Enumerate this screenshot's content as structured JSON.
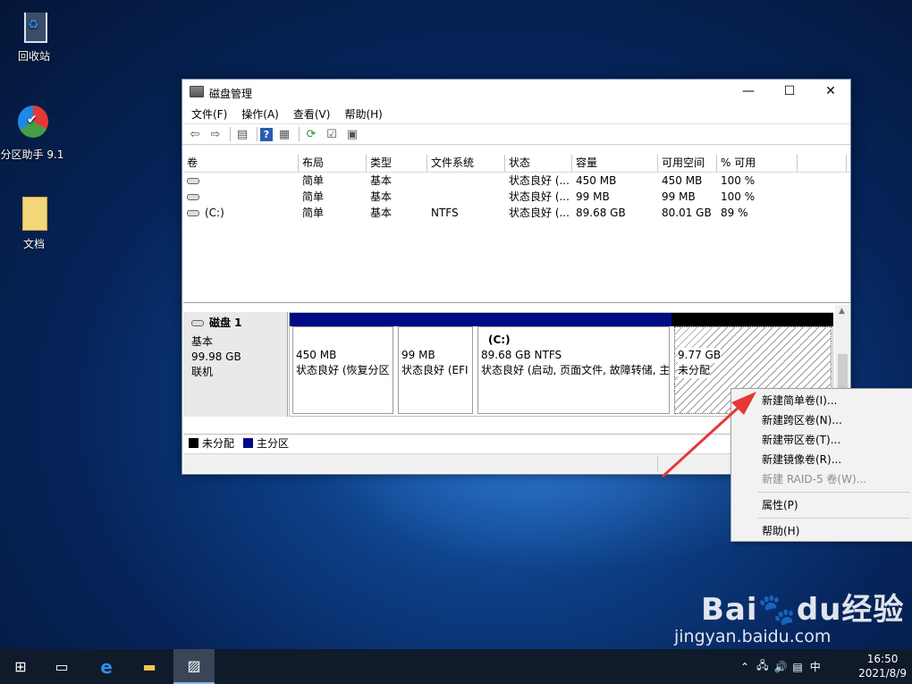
{
  "desktop": {
    "icons": [
      {
        "label": "回收站",
        "icon": "recycle-bin-icon"
      },
      {
        "label": "分区助手 9.1",
        "icon": "partition-assistant-icon"
      },
      {
        "label": "文档",
        "icon": "folder-icon"
      }
    ]
  },
  "window": {
    "title": "磁盘管理",
    "controls": {
      "minimize": "—",
      "maximize": "☐",
      "close": "✕"
    }
  },
  "menubar": {
    "items": [
      "文件(F)",
      "操作(A)",
      "查看(V)",
      "帮助(H)"
    ]
  },
  "toolbar": {
    "icons": [
      "back-icon",
      "forward-icon",
      "list-view-icon",
      "help-icon",
      "console-icon",
      "refresh-icon",
      "properties-icon",
      "export-icon"
    ]
  },
  "volume_list": {
    "columns": [
      "卷",
      "布局",
      "类型",
      "文件系统",
      "状态",
      "容量",
      "可用空间",
      "% 可用"
    ],
    "rows": [
      {
        "volume": "",
        "layout": "简单",
        "type": "基本",
        "fs": "",
        "status": "状态良好 (...",
        "capacity": "450 MB",
        "free": "450 MB",
        "pct": "100 %"
      },
      {
        "volume": "",
        "layout": "简单",
        "type": "基本",
        "fs": "",
        "status": "状态良好 (...",
        "capacity": "99 MB",
        "free": "99 MB",
        "pct": "100 %"
      },
      {
        "volume": "(C:)",
        "layout": "简单",
        "type": "基本",
        "fs": "NTFS",
        "status": "状态良好 (...",
        "capacity": "89.68 GB",
        "free": "80.01 GB",
        "pct": "89 %"
      }
    ]
  },
  "disk": {
    "name": "磁盘 1",
    "type": "基本",
    "size": "99.98 GB",
    "state": "联机",
    "partitions": [
      {
        "label": "",
        "size": "450 MB",
        "status": "状态良好 (恢复分区"
      },
      {
        "label": "",
        "size": "99 MB",
        "status": "状态良好 (EFI"
      },
      {
        "label": "(C:)",
        "size": "89.68 GB NTFS",
        "status": "状态良好 (启动, 页面文件, 故障转储, 主"
      },
      {
        "label": "",
        "size": "9.77 GB",
        "status": "未分配"
      }
    ]
  },
  "legend": {
    "unallocated": "未分配",
    "primary": "主分区"
  },
  "context_menu": {
    "items": [
      {
        "label": "新建简单卷(I)...",
        "enabled": true
      },
      {
        "label": "新建跨区卷(N)...",
        "enabled": true
      },
      {
        "label": "新建带区卷(T)...",
        "enabled": true
      },
      {
        "label": "新建镜像卷(R)...",
        "enabled": true
      },
      {
        "label": "新建 RAID-5 卷(W)...",
        "enabled": false
      },
      {
        "label": "属性(P)",
        "enabled": true
      },
      {
        "label": "帮助(H)",
        "enabled": true
      }
    ]
  },
  "taskbar": {
    "ime": "中",
    "time": "16:50",
    "date": "2021/8/9"
  },
  "watermark": {
    "brand": "Bai",
    "brand2": "du",
    "brand3": "经验",
    "url": "jingyan.baidu.com"
  },
  "colors": {
    "primary_partition": "#000a85",
    "unallocated": "#000000",
    "arrow": "#e53935"
  }
}
